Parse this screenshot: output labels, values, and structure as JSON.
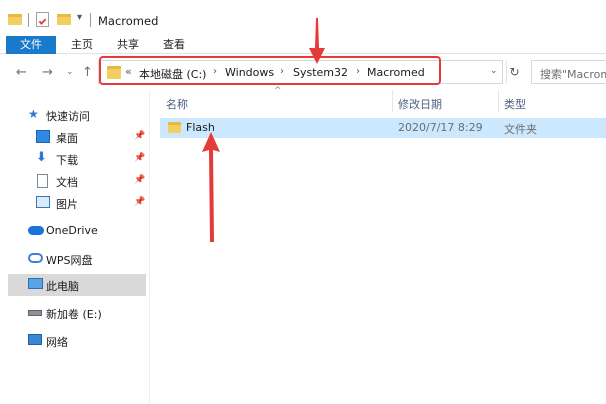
{
  "window": {
    "title": "Macromed"
  },
  "ribbon": {
    "tabs": [
      "文件",
      "主页",
      "共享",
      "查看"
    ]
  },
  "address": {
    "prefix": "«",
    "crumbs": [
      "本地磁盘 (C:)",
      "Windows",
      "System32",
      "Macromed"
    ],
    "separator": "›"
  },
  "search": {
    "placeholder": "搜索\"Macromed\""
  },
  "sidebar": {
    "items": [
      {
        "label": "快速访问",
        "icon": "star-icon"
      },
      {
        "label": "桌面",
        "icon": "desktop-icon",
        "pinned": true
      },
      {
        "label": "下载",
        "icon": "download-icon",
        "pinned": true
      },
      {
        "label": "文档",
        "icon": "document-icon",
        "pinned": true
      },
      {
        "label": "图片",
        "icon": "pictures-icon",
        "pinned": true
      },
      {
        "label": "OneDrive",
        "icon": "cloud-icon"
      },
      {
        "label": "WPS网盘",
        "icon": "wps-cloud-icon"
      },
      {
        "label": "此电脑",
        "icon": "computer-icon",
        "selected": true
      },
      {
        "label": "新加卷 (E:)",
        "icon": "drive-icon"
      },
      {
        "label": "网络",
        "icon": "network-icon"
      }
    ]
  },
  "columns": {
    "name": "名称",
    "modified": "修改日期",
    "type": "类型"
  },
  "files": [
    {
      "name": "Flash",
      "modified": "2020/7/17 8:29",
      "type": "文件夹"
    }
  ],
  "colors": {
    "accent": "#1979ca",
    "selection": "#cce8ff",
    "annotation": "#e53a3a",
    "folder": "#f3cf63"
  }
}
